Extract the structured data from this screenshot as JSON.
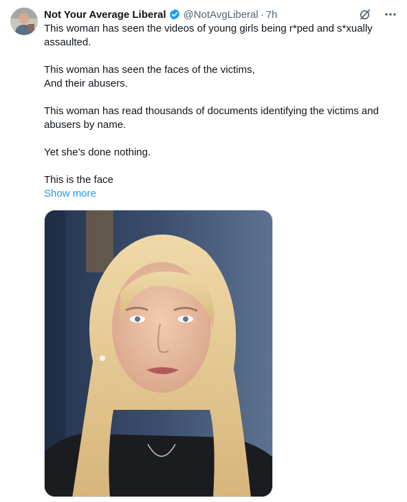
{
  "tweet": {
    "author_name": "Not Your Average Liberal",
    "handle": "@NotAvgLiberal",
    "separator": "·",
    "time": "7h",
    "paragraphs": [
      "This woman has seen the videos of young girls being r*ped and s*xually assaulted.",
      "This woman has seen the faces of the victims,\nAnd their abusers.",
      "This woman has read thousands of documents identifying the victims and abusers by name.",
      "Yet she’s done nothing.",
      "This is the face"
    ],
    "show_more": "Show more"
  },
  "icons": {
    "verified": "verified-badge-icon",
    "grok": "grok-icon",
    "more": "more-options-icon"
  },
  "colors": {
    "text": "#0f1419",
    "secondary": "#536471",
    "link": "#1d9bf0",
    "verified": "#1d9bf0"
  }
}
